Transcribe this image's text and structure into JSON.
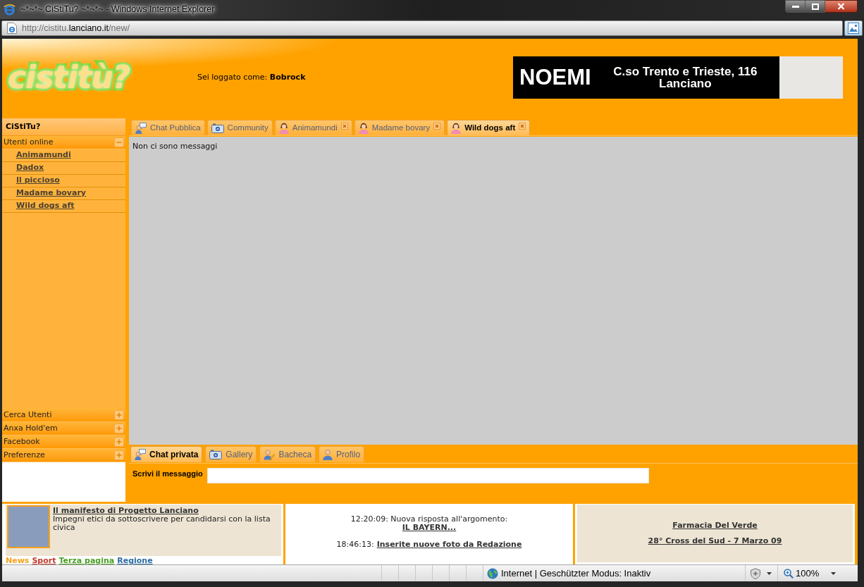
{
  "window": {
    "title": "~*~*~ CiStiTu? ~*~*~ - Windows Internet Explorer"
  },
  "address_bar": {
    "url_start": "http://cistitu.",
    "url_domain": "lanciano.it",
    "url_end": "/new/"
  },
  "header": {
    "logo": "cistitù?",
    "login": "Sei loggato come: **Bobrock**",
    "banner": {
      "brand": "NOEMI",
      "address": [
        "C.so Trento e Trieste, 116",
        "Lanciano"
      ]
    }
  },
  "sidebar": {
    "title": "CiStiTu?",
    "sections": [
      {
        "label": "Utenti online",
        "expanded": true,
        "items": [
          "Animamundi",
          "Dadox",
          "Il piccioso",
          "Madame bovary",
          "Wild dogs aft"
        ]
      },
      {
        "label": "Cerca Utenti",
        "expanded": false
      },
      {
        "label": "Anxa Hold'em",
        "expanded": false
      },
      {
        "label": "Facebook",
        "expanded": false
      },
      {
        "label": "Preferenze",
        "expanded": false
      }
    ]
  },
  "tabs": [
    {
      "label": "Chat Pubblica",
      "kind": "chat",
      "closable": false,
      "selected": false
    },
    {
      "label": "Community",
      "kind": "camera",
      "closable": false,
      "selected": false
    },
    {
      "label": "Animamundi",
      "kind": "female-user",
      "closable": true,
      "selected": false
    },
    {
      "label": "Madame bovary",
      "kind": "female-user",
      "closable": true,
      "selected": false
    },
    {
      "label": "Wild dogs aft",
      "kind": "female-user",
      "closable": true,
      "selected": true
    }
  ],
  "chat": {
    "message": "Non ci sono messaggi"
  },
  "bottom_tabs": [
    {
      "label": "Chat privata",
      "kind": "chat",
      "selected": true
    },
    {
      "label": "Gallery",
      "kind": "camera",
      "selected": false
    },
    {
      "label": "Bacheca",
      "kind": "user-pencil",
      "selected": false
    },
    {
      "label": "Profilo",
      "kind": "user",
      "selected": false
    }
  ],
  "compose": {
    "label": "Scrivi il messaggio"
  },
  "news": {
    "title": "Il manifesto di Progetto Lanciano",
    "description": "Impegni etici da sottoscrivere per candidarsi con la lista civica",
    "categories": [
      {
        "label": "News",
        "color": "#f7a21b",
        "selected": true
      },
      {
        "label": "Sport",
        "color": "#c0392b",
        "selected": false
      },
      {
        "label": "Terza pagina",
        "color": "#4a9e24",
        "selected": false
      },
      {
        "label": "Regione",
        "color": "#2a6aa0",
        "selected": false
      }
    ]
  },
  "activity": [
    {
      "kind": "stacked",
      "text": "12:20:09: Nuova risposta all'argomento:",
      "link": "IL BAYERN..."
    },
    {
      "kind": "inline",
      "text": "18:46:13:",
      "link": "Inserite nuove foto da Redazione"
    }
  ],
  "links": [
    "Farmacia Del Verde",
    "28° Cross del Sud - 7 Marzo 09"
  ],
  "status_bar": {
    "zone": "Internet | Geschützter Modus: Inaktiv",
    "zoom": "100%"
  }
}
